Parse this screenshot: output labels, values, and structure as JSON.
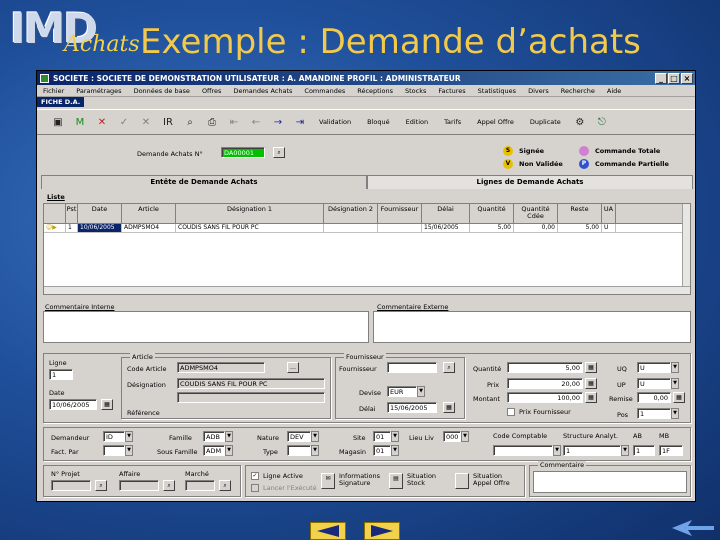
{
  "slide": {
    "logo_main": "IMD",
    "logo_sub": "Achats",
    "title": "Exemple : Demande d’achats"
  },
  "window": {
    "title": "SOCIETE : SOCIETE DE DEMONSTRATION   UTILISATEUR : A. AMANDINE   PROFIL : ADMINISTRATEUR",
    "menu": [
      "Fichier",
      "Paramétrages",
      "Données de base",
      "Offres",
      "Demandes Achats",
      "Commandes",
      "Réceptions",
      "Stocks",
      "Factures",
      "Statistiques",
      "Divers",
      "Recherche",
      "Aide"
    ],
    "form_tag": "FICHE D.A."
  },
  "toolbar": {
    "buttons": [
      "Validation",
      "Bloqué",
      "Edition",
      "Tarifs",
      "Appel Offre",
      "Duplicate"
    ]
  },
  "header": {
    "da_label": "Demande Achats N°",
    "da_value": "DA00001",
    "legend": [
      {
        "letter": "S",
        "label": "Signée",
        "color": "#e8c000"
      },
      {
        "letter": "V",
        "label": "Non Validée",
        "color": "#e8c000"
      },
      {
        "letter": "",
        "label": "Commande Totale",
        "color": "#d080d0"
      },
      {
        "letter": "P",
        "label": "Commande Partielle",
        "color": "#3050d0"
      }
    ]
  },
  "tabs": [
    "Entête de Demande Achats",
    "Lignes de Demande Achats"
  ],
  "list": {
    "title": "Liste",
    "columns": [
      "Pst",
      "Date",
      "Article",
      "Désignation 1",
      "Désignation 2",
      "Fournisseur",
      "Délai",
      "Quantité",
      "Quantité Cdée",
      "Reste",
      "UA"
    ],
    "rows": [
      [
        "1",
        "10/06/2005",
        "ADMPSMO4",
        "COUDIS SANS FIL POUR PC",
        "",
        "",
        "15/06/2005",
        "5,00",
        "0,00",
        "5,00",
        "U"
      ]
    ]
  },
  "comments": {
    "internal": "Commentaire Interne",
    "external": "Commentaire Externe"
  },
  "detail": {
    "ligne_label": "Ligne",
    "ligne_value": "1",
    "date_label": "Date",
    "date_value": "10/06/2005",
    "article_group": "Article",
    "code_article_label": "Code Article",
    "code_article_value": "ADMPSMO4",
    "designation_label": "Désignation",
    "designation_value": "COUDIS SANS FIL POUR PC",
    "reference_label": "Référence",
    "fournisseur_group": "Fournisseur",
    "fournisseur_label": "Fournisseur",
    "devise_label": "Devise",
    "devise_value": "EUR",
    "delai_label": "Délai",
    "delai_value": "15/06/2005",
    "quantite_label": "Quantité",
    "quantite_value": "5,00",
    "prix_label": "Prix",
    "prix_value": "20,00",
    "montant_label": "Montant",
    "montant_value": "100,00",
    "prix_fournisseur_label": "Prix Fournisseur",
    "uq_label": "UQ",
    "uq_value": "U",
    "up_label": "UP",
    "up_value": "U",
    "remise_label": "Remise",
    "remise_value": "0,00",
    "pos_label": "Pos",
    "pos_value": "1"
  },
  "classification": {
    "demandeur_label": "Demandeur",
    "demandeur_value": "ID",
    "fact_par_label": "Fact. Par",
    "famille_label": "Famille",
    "famille_value": "ADB",
    "sous_famille_label": "Sous Famille",
    "sous_famille_value": "ADM",
    "nature_label": "Nature",
    "nature_value": "DEV",
    "type_label": "Type",
    "site_label": "Site",
    "site_value": "01",
    "lieu_label": "Lieu Liv",
    "lieu_value": "000",
    "magasin_label": "Magasin",
    "magasin_value": "01",
    "compte_label": "Code Comptable",
    "section_label": "Structure Analyt.",
    "ab_label": "AB",
    "mb_label": "MB",
    "section_value": "1",
    "ab_value": "1",
    "mb_value": "1F"
  },
  "footer": {
    "no_projet_label": "N° Projet",
    "affaire_label": "Affaire",
    "marche_label": "Marché",
    "ligne_active_label": "Ligne Active",
    "lancer_label": "Lancer l'Exécuté",
    "info_signature_label": "Informations Signature",
    "situation_stock_label": "Situation Stock",
    "situation_appel_label": "Situation Appel Offre",
    "commentaire_label": "Commentaire"
  }
}
